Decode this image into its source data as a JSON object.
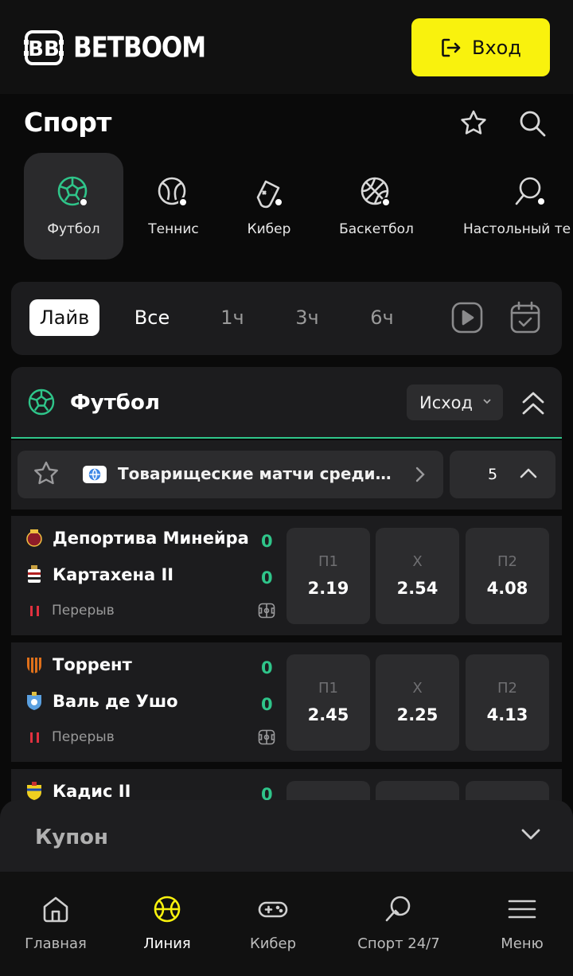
{
  "header": {
    "brand": "BETBOOM",
    "login_label": "Вход"
  },
  "sport": {
    "title": "Спорт"
  },
  "categories": [
    {
      "label": "Футбол",
      "icon": "football-icon",
      "active": true
    },
    {
      "label": "Теннис",
      "icon": "tennis-icon",
      "active": false
    },
    {
      "label": "Кибер",
      "icon": "cyber-icon",
      "active": false
    },
    {
      "label": "Баскетбол",
      "icon": "basketball-icon",
      "active": false
    },
    {
      "label": "Настольный те",
      "icon": "table-tennis-icon",
      "active": false
    }
  ],
  "filters": [
    {
      "label": "Лайв",
      "selected": true
    },
    {
      "label": "Все",
      "selected": false
    },
    {
      "label": "1ч",
      "selected": false
    },
    {
      "label": "3ч",
      "selected": false
    },
    {
      "label": "6ч",
      "selected": false
    }
  ],
  "section": {
    "title": "Футбол",
    "outcome_label": "Исход"
  },
  "league": {
    "name": "Товарищеские матчи среди клу...",
    "count": "5"
  },
  "matches": [
    {
      "home": "Депортива Минейра",
      "away": "Картахена II",
      "home_score": "0",
      "away_score": "0",
      "status": "Перерыв",
      "odds": [
        {
          "label": "П1",
          "value": "2.19"
        },
        {
          "label": "Х",
          "value": "2.54"
        },
        {
          "label": "П2",
          "value": "4.08"
        }
      ]
    },
    {
      "home": "Торрент",
      "away": "Валь де Ушо",
      "home_score": "0",
      "away_score": "0",
      "status": "Перерыв",
      "odds": [
        {
          "label": "П1",
          "value": "2.45"
        },
        {
          "label": "Х",
          "value": "2.25"
        },
        {
          "label": "П2",
          "value": "4.13"
        }
      ]
    },
    {
      "home": "Кадис II",
      "home_score": "0"
    }
  ],
  "coupon": {
    "title": "Купон"
  },
  "bottom_nav": [
    {
      "label": "Главная",
      "icon": "home-icon"
    },
    {
      "label": "Линия",
      "icon": "line-ball-icon",
      "active": true
    },
    {
      "label": "Кибер",
      "icon": "gamepad-icon"
    },
    {
      "label": "Спорт 24/7",
      "icon": "ping-pong-icon"
    },
    {
      "label": "Меню",
      "icon": "menu-icon"
    }
  ],
  "colors": {
    "accent_yellow": "#f9f20d",
    "accent_green": "#2fc58a",
    "live_red": "#e0313f"
  }
}
